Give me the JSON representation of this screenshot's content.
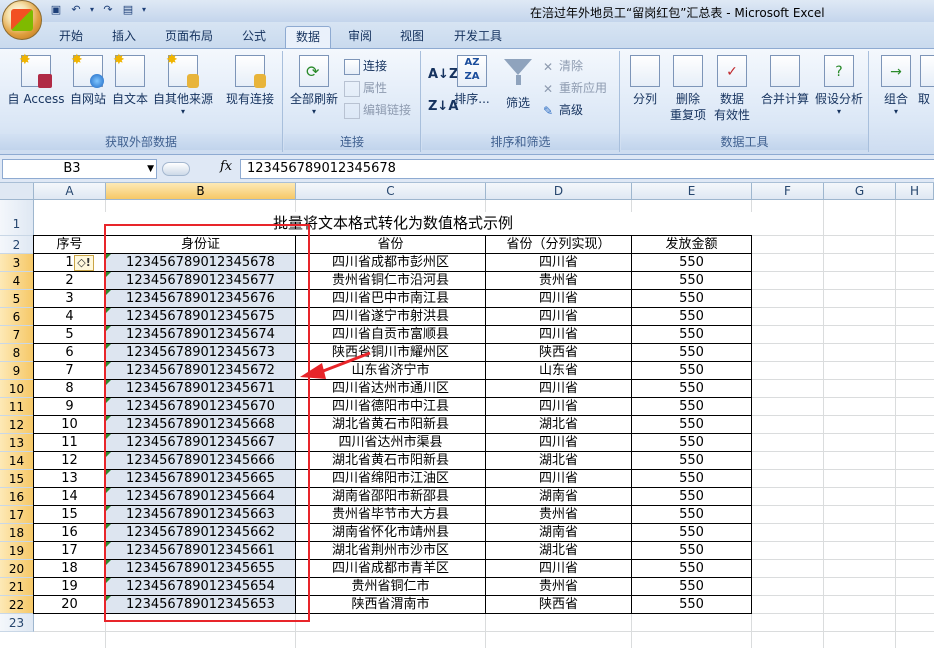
{
  "window": {
    "title": "在涪过年外地员工“留岗红包”汇总表 - Microsoft Excel"
  },
  "tabs": [
    "开始",
    "插入",
    "页面布局",
    "公式",
    "数据",
    "审阅",
    "视图",
    "开发工具"
  ],
  "active_tab": "数据",
  "ribbon": {
    "get_external": {
      "label": "获取外部数据",
      "buttons": [
        "自 Access",
        "自网站",
        "自文本",
        "自其他来源",
        "现有连接"
      ]
    },
    "connections": {
      "label": "连接",
      "refresh_all": "全部刷新",
      "connect": "连接",
      "properties": "属性",
      "edit_links": "编辑链接"
    },
    "sort_filter": {
      "label": "排序和筛选",
      "sort": "排序...",
      "filter": "筛选",
      "clear": "清除",
      "reapply": "重新应用",
      "advanced": "高级"
    },
    "data_tools": {
      "label": "数据工具",
      "split": "分列",
      "remove_dup_1": "删除",
      "remove_dup_2": "重复项",
      "validation_1": "数据",
      "validation_2": "有效性",
      "consolidate": "合并计算",
      "whatif": "假设分析"
    },
    "outline": {
      "group": "组合",
      "ungroup": "取"
    }
  },
  "formula_bar": {
    "name_box": "B3",
    "fx_label": "fx",
    "formula": "123456789012345678"
  },
  "columns": [
    "A",
    "B",
    "C",
    "D",
    "E",
    "F",
    "G",
    "H"
  ],
  "selected_column": "B",
  "sheet": {
    "title": "批量将文本格式转化为数值格式示例",
    "headers": [
      "序号",
      "身份证",
      "省份",
      "省份（分列实现）",
      "发放金额"
    ],
    "rows": [
      [
        "1",
        "123456789012345678",
        "四川省成都市彭州区",
        "四川省",
        "550"
      ],
      [
        "2",
        "123456789012345677",
        "贵州省铜仁市沿河县",
        "贵州省",
        "550"
      ],
      [
        "3",
        "123456789012345676",
        "四川省巴中市南江县",
        "四川省",
        "550"
      ],
      [
        "4",
        "123456789012345675",
        "四川省遂宁市射洪县",
        "四川省",
        "550"
      ],
      [
        "5",
        "123456789012345674",
        "四川省自贡市富顺县",
        "四川省",
        "550"
      ],
      [
        "6",
        "123456789012345673",
        "陕西省铜川市耀州区",
        "陕西省",
        "550"
      ],
      [
        "7",
        "123456789012345672",
        "山东省济宁市",
        "山东省",
        "550"
      ],
      [
        "8",
        "123456789012345671",
        "四川省达州市通川区",
        "四川省",
        "550"
      ],
      [
        "9",
        "123456789012345670",
        "四川省德阳市中江县",
        "四川省",
        "550"
      ],
      [
        "10",
        "123456789012345668",
        "湖北省黄石市阳新县",
        "湖北省",
        "550"
      ],
      [
        "11",
        "123456789012345667",
        "四川省达州市渠县",
        "四川省",
        "550"
      ],
      [
        "12",
        "123456789012345666",
        "湖北省黄石市阳新县",
        "湖北省",
        "550"
      ],
      [
        "13",
        "123456789012345665",
        "四川省绵阳市江油区",
        "四川省",
        "550"
      ],
      [
        "14",
        "123456789012345664",
        "湖南省邵阳市新邵县",
        "湖南省",
        "550"
      ],
      [
        "15",
        "123456789012345663",
        "贵州省毕节市大方县",
        "贵州省",
        "550"
      ],
      [
        "16",
        "123456789012345662",
        "湖南省怀化市靖州县",
        "湖南省",
        "550"
      ],
      [
        "17",
        "123456789012345661",
        "湖北省荆州市沙市区",
        "湖北省",
        "550"
      ],
      [
        "18",
        "123456789012345655",
        "四川省成都市青羊区",
        "四川省",
        "550"
      ],
      [
        "19",
        "123456789012345654",
        "贵州省铜仁市",
        "贵州省",
        "550"
      ],
      [
        "20",
        "123456789012345653",
        "陕西省渭南市",
        "陕西省",
        "550"
      ]
    ],
    "row_numbers": [
      "1",
      "2",
      "3",
      "4",
      "5",
      "6",
      "7",
      "8",
      "9",
      "10",
      "11",
      "12",
      "13",
      "14",
      "15",
      "16",
      "17",
      "18",
      "19",
      "20",
      "21",
      "22",
      "23"
    ]
  },
  "colors": {
    "highlight_red": "#e8252a",
    "selected_header": "#f6c867",
    "selection_fill": "#dde5f0",
    "text_number_triangle": "#2f8a2f"
  }
}
